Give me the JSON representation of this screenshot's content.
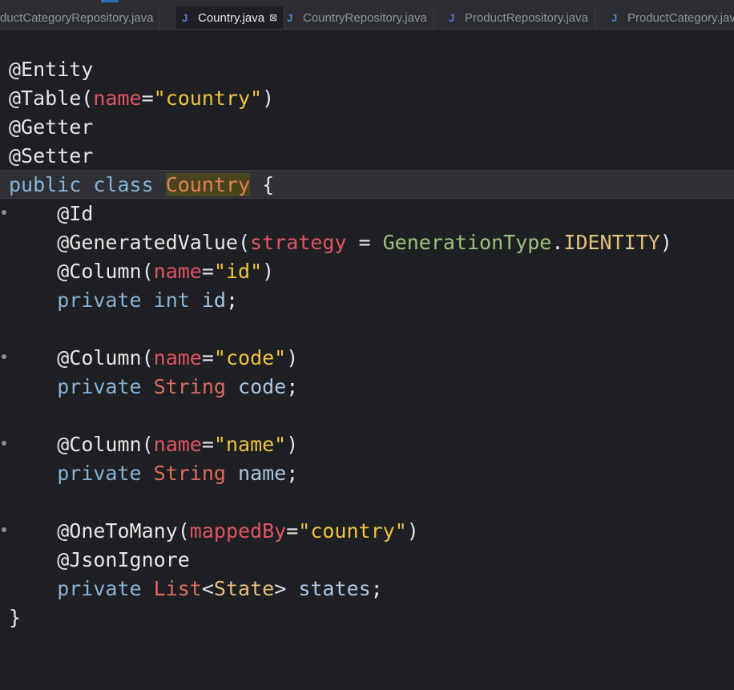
{
  "tabs": [
    {
      "label": "ductCategoryRepository.java",
      "active": false,
      "icon": "java-file-icon"
    },
    {
      "label": "Country.java",
      "active": true,
      "icon": "java-file-icon",
      "close": "⊠"
    },
    {
      "label": "CountryRepository.java",
      "active": false,
      "icon": "java-file-icon"
    },
    {
      "label": "ProductRepository.java",
      "active": false,
      "icon": "java-file-icon"
    },
    {
      "label": "ProductCategory.java",
      "active": false,
      "icon": "java-file-icon"
    }
  ],
  "code": {
    "l1": "@Entity",
    "l2": {
      "ann": "@Table(",
      "attr": "name",
      "eq": "=",
      "str": "\"country\"",
      "end": ")"
    },
    "l3": "@Getter",
    "l4": "@Setter",
    "l5": {
      "kw1": "public",
      "kw2": "class",
      "name": "Country",
      "brace": "{"
    },
    "l6": "@Id",
    "l7": {
      "ann": "@GeneratedValue(",
      "attr": "strategy",
      "eq": " = ",
      "enum": "GenerationType",
      "dot": ".",
      "const": "IDENTITY",
      "end": ")"
    },
    "l8": {
      "ann": "@Column(",
      "attr": "name",
      "eq": "=",
      "str": "\"id\"",
      "end": ")"
    },
    "l9": {
      "kw": "private",
      "type": "int",
      "field": "id",
      "semi": ";"
    },
    "l11": {
      "ann": "@Column(",
      "attr": "name",
      "eq": "=",
      "str": "\"code\"",
      "end": ")"
    },
    "l12": {
      "kw": "private",
      "type": "String",
      "field": "code",
      "semi": ";"
    },
    "l14": {
      "ann": "@Column(",
      "attr": "name",
      "eq": "=",
      "str": "\"name\"",
      "end": ")"
    },
    "l15": {
      "kw": "private",
      "type": "String",
      "field": "name",
      "semi": ";"
    },
    "l17": {
      "ann": "@OneToMany(",
      "attr": "mappedBy",
      "eq": "=",
      "str": "\"country\"",
      "end": ")"
    },
    "l18": "@JsonIgnore",
    "l19": {
      "kw": "private",
      "type": "List",
      "lt": "<",
      "generic": "State",
      "gt": ">",
      "field": "states",
      "semi": ";"
    },
    "l20": "}"
  }
}
